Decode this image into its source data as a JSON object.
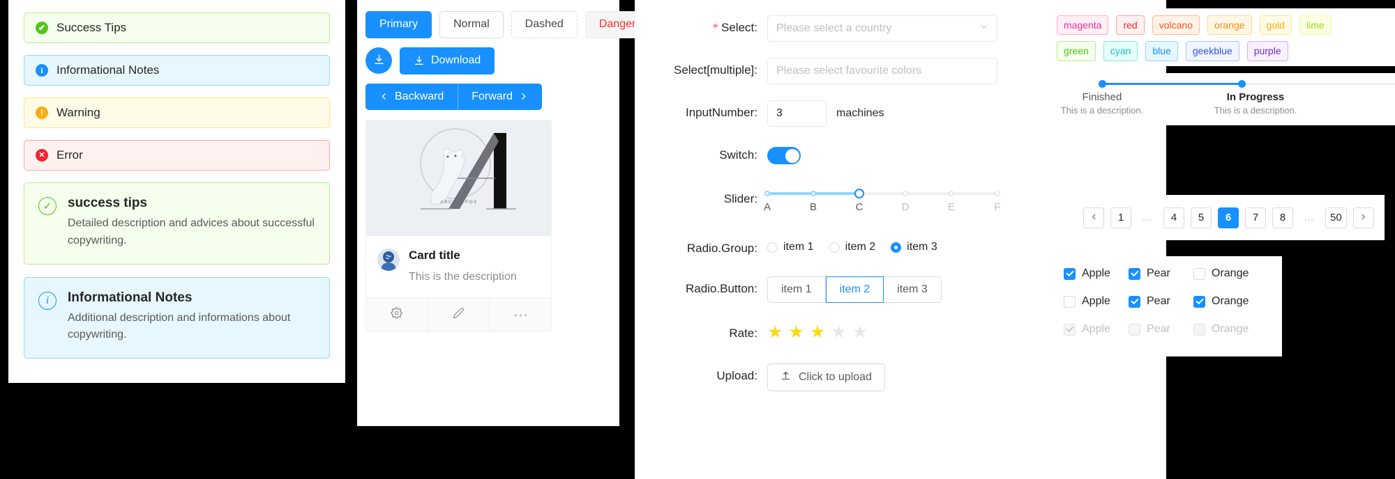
{
  "alerts": {
    "bars": [
      {
        "icon": "check-circle-icon",
        "kind": "success",
        "label": "Success Tips",
        "glyph": "✔"
      },
      {
        "icon": "info-circle-icon",
        "kind": "info",
        "label": "Informational Notes",
        "glyph": "i"
      },
      {
        "icon": "warning-circle-icon",
        "kind": "warning",
        "label": "Warning",
        "glyph": "!"
      },
      {
        "icon": "close-circle-icon",
        "kind": "error",
        "label": "Error",
        "glyph": "✕"
      }
    ],
    "boxes": [
      {
        "kind": "success",
        "icon": "check-circle-outline-icon",
        "glyph": "✓",
        "title": "success tips",
        "desc": "Detailed description and advices about successful copywriting."
      },
      {
        "kind": "info",
        "icon": "info-circle-outline-icon",
        "glyph": "i",
        "title": "Informational Notes",
        "desc": "Additional description and informations about copywriting."
      }
    ]
  },
  "buttons": {
    "row1": [
      {
        "label": "Primary",
        "style": "primary"
      },
      {
        "label": "Normal",
        "style": "normal"
      },
      {
        "label": "Dashed",
        "style": "dashed"
      },
      {
        "label": "Danger",
        "style": "danger"
      }
    ],
    "download_label": "Download",
    "backward_label": "Backward",
    "forward_label": "Forward"
  },
  "card": {
    "cover_caption": "ARCTIC FOX",
    "title": "Card title",
    "description": "This is the description",
    "actions": [
      "setting-icon",
      "edit-icon",
      "ellipsis-icon"
    ]
  },
  "form": {
    "select": {
      "label": "Select",
      "required": true,
      "placeholder": "Please select a country",
      "value": ""
    },
    "select_multiple": {
      "label": "Select[multiple]",
      "placeholder": "Please select favourite colors",
      "value": ""
    },
    "input_number": {
      "label": "InputNumber",
      "value": "3",
      "suffix": "machines"
    },
    "switch": {
      "label": "Switch",
      "checked": true
    },
    "slider": {
      "label": "Slider",
      "marks": [
        "A",
        "B",
        "C",
        "D",
        "E",
        "F"
      ],
      "value_index": 2,
      "percent": 40
    },
    "radio_group": {
      "label": "Radio.Group",
      "options": [
        "item 1",
        "item 2",
        "item 3"
      ],
      "selected": "item 3"
    },
    "radio_button": {
      "label": "Radio.Button",
      "options": [
        "item 1",
        "item 2",
        "item 3"
      ],
      "selected": "item 2"
    },
    "rate": {
      "label": "Rate",
      "value": 3,
      "max": 5
    },
    "upload": {
      "label": "Upload",
      "button_label": "Click to upload",
      "icon": "upload-icon"
    }
  },
  "tags": {
    "row1": [
      {
        "label": "magenta",
        "color": "#eb2f96",
        "bg": "#fff0f6",
        "border": "#ffadd2"
      },
      {
        "label": "red",
        "color": "#f5222d",
        "bg": "#fff1f0",
        "border": "#ffa39e"
      },
      {
        "label": "volcano",
        "color": "#fa541c",
        "bg": "#fff2e8",
        "border": "#ffbb96"
      },
      {
        "label": "orange",
        "color": "#fa8c16",
        "bg": "#fff7e6",
        "border": "#ffd591"
      },
      {
        "label": "gold",
        "color": "#faad14",
        "bg": "#fffbe6",
        "border": "#ffe58f"
      },
      {
        "label": "lime",
        "color": "#a0d911",
        "bg": "#fcffe6",
        "border": "#eaff8f"
      }
    ],
    "row2": [
      {
        "label": "green",
        "color": "#52c41a",
        "bg": "#f6ffed",
        "border": "#b7eb8f"
      },
      {
        "label": "cyan",
        "color": "#13c2c2",
        "bg": "#e6fffb",
        "border": "#87e8de"
      },
      {
        "label": "blue",
        "color": "#1890ff",
        "bg": "#e6f7ff",
        "border": "#91d5ff"
      },
      {
        "label": "geekblue",
        "color": "#2f54eb",
        "bg": "#f0f5ff",
        "border": "#adc6ff"
      },
      {
        "label": "purple",
        "color": "#722ed1",
        "bg": "#f9f0ff",
        "border": "#d3adf7"
      }
    ]
  },
  "steps": [
    {
      "title": "Finished",
      "description": "This is a description.",
      "state": "finish"
    },
    {
      "title": "In Progress",
      "description": "This is a description.",
      "state": "process"
    }
  ],
  "pagination": {
    "prev_icon": "chevron-left-icon",
    "next_icon": "chevron-right-icon",
    "items": [
      "1",
      "…",
      "4",
      "5",
      "6",
      "7",
      "8",
      "…",
      "50"
    ],
    "current": "6"
  },
  "checkboxes": {
    "rows": [
      [
        {
          "label": "Apple",
          "checked": true,
          "disabled": false
        },
        {
          "label": "Pear",
          "checked": true,
          "disabled": false
        },
        {
          "label": "Orange",
          "checked": false,
          "disabled": false
        }
      ],
      [
        {
          "label": "Apple",
          "checked": false,
          "disabled": false
        },
        {
          "label": "Pear",
          "checked": true,
          "disabled": false
        },
        {
          "label": "Orange",
          "checked": true,
          "disabled": false
        }
      ],
      [
        {
          "label": "Apple",
          "checked": true,
          "disabled": true
        },
        {
          "label": "Pear",
          "checked": false,
          "disabled": true
        },
        {
          "label": "Orange",
          "checked": false,
          "disabled": true
        }
      ]
    ]
  },
  "theme": {
    "primary": "#1890ff",
    "success": "#52c41a",
    "warning": "#faad14",
    "error": "#f5222d"
  }
}
